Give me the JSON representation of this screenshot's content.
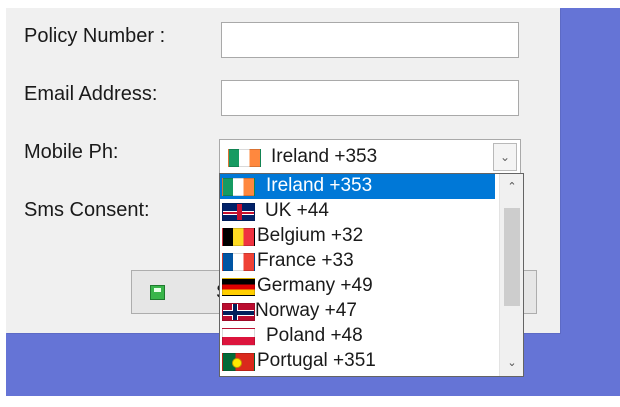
{
  "form": {
    "policy_number_label": "Policy Number :",
    "email_address_label": "Email Address:",
    "mobile_phone_label": "Mobile Ph:",
    "sms_consent_label": "Sms Consent:",
    "policy_number_value": "",
    "email_address_value": "",
    "mobile_selected": {
      "flag_icon": "ireland-flag-icon",
      "label": "Ireland +353"
    }
  },
  "buttons": {
    "save_label": "S"
  },
  "dropdown": {
    "items": [
      {
        "label": "Ireland +353",
        "flag_icon": "ireland-flag-icon",
        "selected": true
      },
      {
        "label": "UK +44",
        "flag_icon": "uk-flag-icon",
        "selected": false
      },
      {
        "label": "Belgium +32",
        "flag_icon": "belgium-flag-icon",
        "selected": false
      },
      {
        "label": "France +33",
        "flag_icon": "france-flag-icon",
        "selected": false
      },
      {
        "label": "Germany +49",
        "flag_icon": "germany-flag-icon",
        "selected": false
      },
      {
        "label": "Norway +47",
        "flag_icon": "norway-flag-icon",
        "selected": false
      },
      {
        "label": "Poland +48",
        "flag_icon": "poland-flag-icon",
        "selected": false
      },
      {
        "label": "Portugal +351",
        "flag_icon": "portugal-flag-icon",
        "selected": false
      }
    ]
  },
  "colors": {
    "background_blue": "#6574d6",
    "form_background": "#f0f0f0",
    "selection_highlight": "#0078d7"
  }
}
